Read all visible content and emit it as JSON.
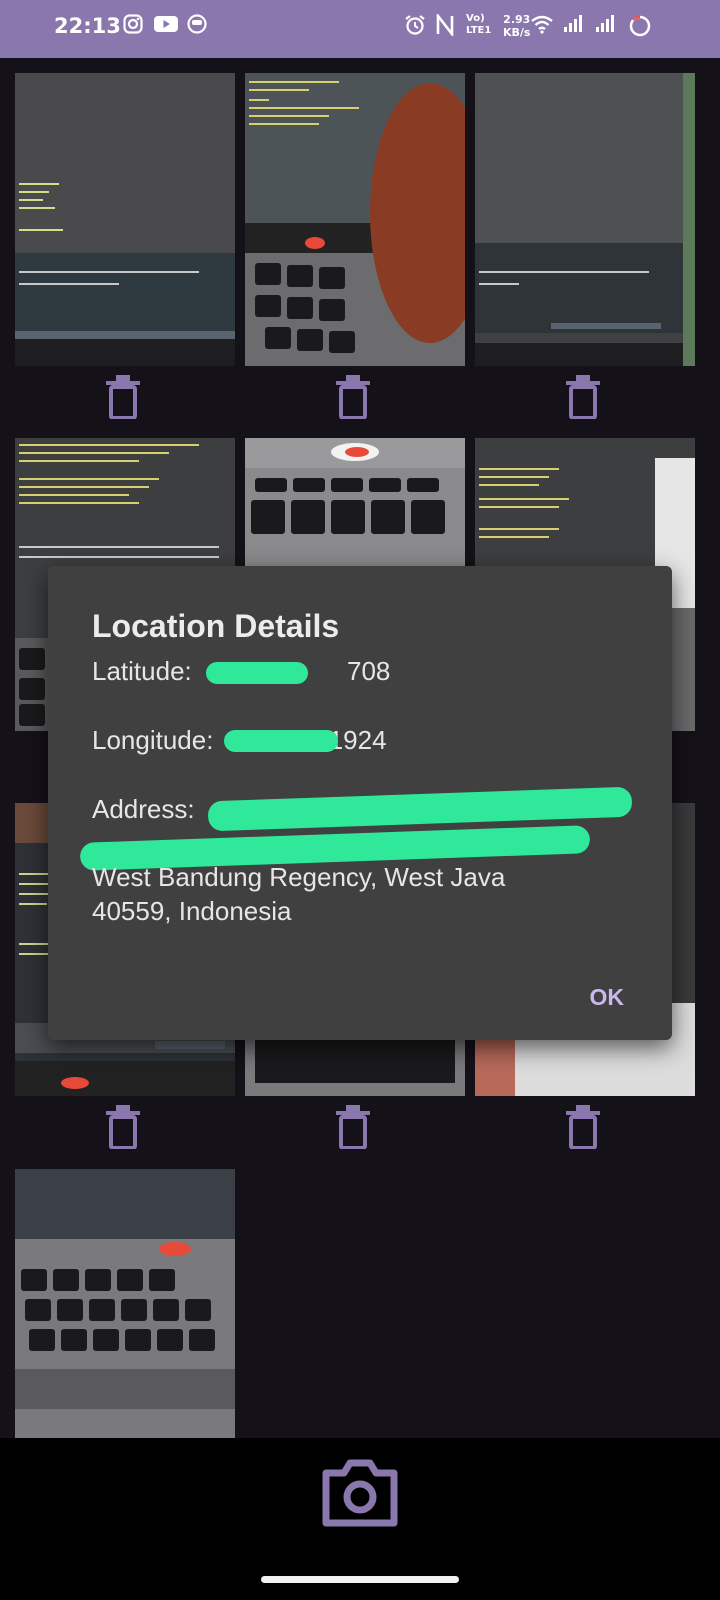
{
  "status_bar": {
    "time": "22:13",
    "volte_top": "Vo)",
    "volte_bottom": "LTE1",
    "net_speed_value": "2.93",
    "net_speed_unit": "KB/s"
  },
  "dialog": {
    "title": "Location Details",
    "latitude_label": "Latitude:",
    "latitude_visible_suffix": "708",
    "longitude_label": "Longitude:",
    "longitude_visible_suffix": "1924",
    "address_label": "Address:",
    "address_line_3": "West Bandung Regency, West Java",
    "address_line_4": "40559, Indonesia",
    "ok_label": "OK"
  },
  "icons": {
    "trash": "trash-icon",
    "camera": "camera-icon",
    "accent_color": "#8a77ad",
    "redaction_color": "#2fe89a"
  }
}
